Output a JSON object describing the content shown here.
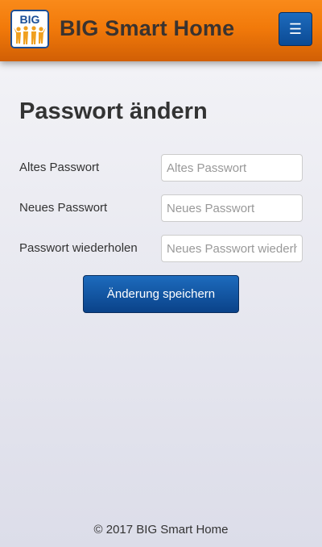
{
  "header": {
    "logo_text": "BIG",
    "brand": "BIG Smart Home",
    "menu_icon": "☰"
  },
  "page": {
    "title": "Passwort ändern"
  },
  "form": {
    "fields": [
      {
        "label": "Altes Passwort",
        "placeholder": "Altes Passwort",
        "value": ""
      },
      {
        "label": "Neues Passwort",
        "placeholder": "Neues Passwort",
        "value": ""
      },
      {
        "label": "Passwort wiederholen",
        "placeholder": "Neues Passwort wiederholen",
        "value": ""
      }
    ],
    "submit_label": "Änderung speichern"
  },
  "footer": {
    "text": "© 2017 BIG Smart Home"
  },
  "colors": {
    "header_orange": "#f27a0a",
    "button_blue": "#0b4a94",
    "logo_blue": "#1a4e96"
  }
}
